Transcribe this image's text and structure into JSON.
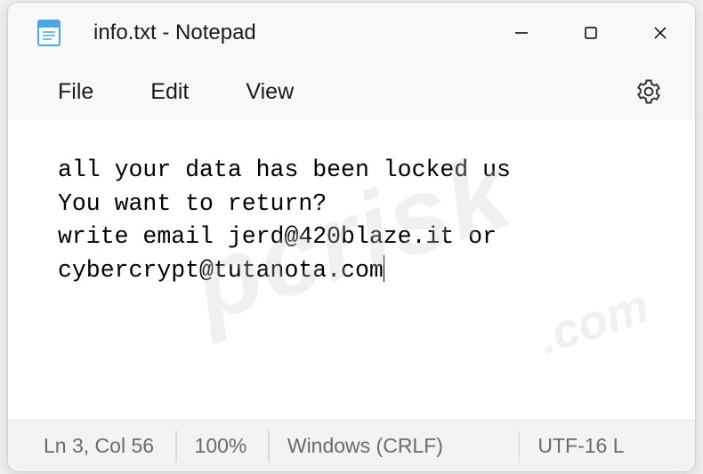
{
  "titlebar": {
    "title": "info.txt - Notepad"
  },
  "menu": {
    "file": "File",
    "edit": "Edit",
    "view": "View"
  },
  "content": {
    "text": "all your data has been locked us\nYou want to return?\nwrite email jerd@420blaze.it or cybercrypt@tutanota.com"
  },
  "statusbar": {
    "position": "Ln 3, Col 56",
    "zoom": "100%",
    "line_ending": "Windows (CRLF)",
    "encoding": "UTF-16 L"
  },
  "watermark": {
    "main": "pcrisk",
    "sub": ".com"
  }
}
